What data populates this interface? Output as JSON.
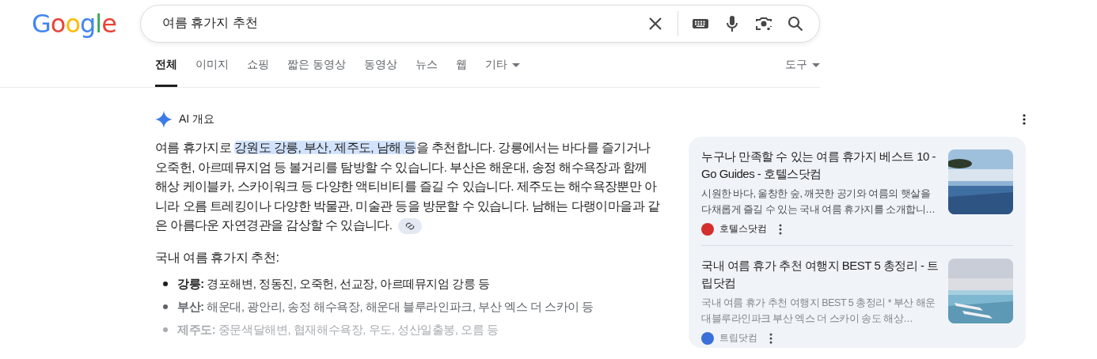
{
  "logo": "Google",
  "search": {
    "value": "여름 휴가지 추천"
  },
  "tabs": [
    {
      "label": "전체",
      "selected": true
    },
    {
      "label": "이미지",
      "selected": false
    },
    {
      "label": "쇼핑",
      "selected": false
    },
    {
      "label": "짧은 동영상",
      "selected": false
    },
    {
      "label": "동영상",
      "selected": false
    },
    {
      "label": "뉴스",
      "selected": false
    },
    {
      "label": "웹",
      "selected": false
    },
    {
      "label": "기타",
      "selected": false,
      "kind": "menu"
    }
  ],
  "tools": "도구",
  "ai_overview": {
    "title": "AI 개요",
    "paragraph": [
      {
        "text": "여름 휴가지로 ",
        "highlighted": false
      },
      {
        "text": "강원도 강릉, 부산, 제주도, 남해 등",
        "highlighted": true
      },
      {
        "text": "을 추천합니다. 강릉에서는 바다를 즐기거나 오죽헌, 아르떼뮤지엄 등 볼거리를 탐방할 수 있습니다. 부산은 해운대, 송정 해수욕장과 함께 해상 케이블카, 스카이워크 등 다양한 액티비티를 즐길 수 있습니다. 제주도는 해수욕장뿐만 아니라 오름 트레킹이나 다양한 박물관, 미술관 등을 방문할 수 있습니다. 남해는 다랭이마을과 같은 아름다운 자연경관을 감상할 수 있습니다.",
        "highlighted": false
      }
    ],
    "heading": "국내 여름 휴가지 추천:",
    "bullets": [
      "**강릉:** 경포해변, 정동진, 오죽헌, 선교장, 아르떼뮤지엄 강릉 등",
      "**부산:** 해운대, 광안리, 송정 해수욕장, 해운대 블루라인파크, 부산 엑스 더 스카이 등",
      "**제주도:** 중문색달해변, 협재해수욕장, 우도, 성산일출봉, 오름 등"
    ]
  },
  "sources": [
    {
      "title": "누구나 만족할 수 있는 여름 휴가지 베스트 10 - Go Guides - 호텔스닷컴",
      "snippet": "시원한 바다, 울창한 숲, 깨끗한 공기와 여름의 햇살을 다채롭게 즐길 수 있는 국내 여름 휴가지를 소개합니…",
      "site": "호텔스닷컴",
      "color": "#d32f2f"
    },
    {
      "title": "국내 여름 휴가 추천 여행지 BEST 5 총정리 - 트립닷컴",
      "snippet": "국내 여름 휴가 추천 여행지 BEST 5 총정리 * 부산 해운대블루라인파크 부산 엑스 더 스카이 송도 해상…",
      "site": "트립닷컴",
      "color": "#3b6fd9"
    }
  ]
}
